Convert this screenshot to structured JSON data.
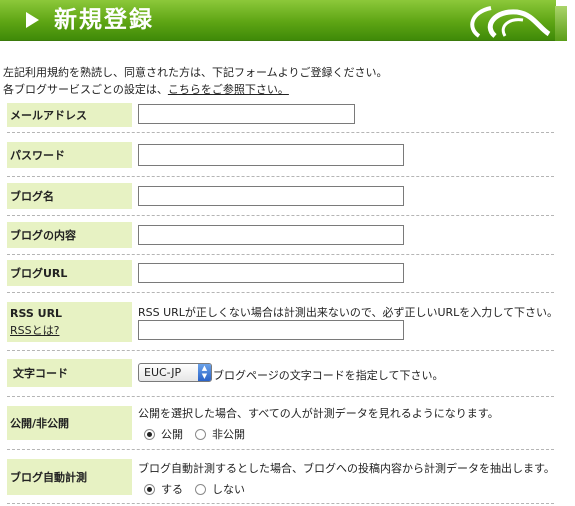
{
  "header": {
    "title": "新規登録"
  },
  "intro": {
    "line1": "左記利用規約を熟読し、同意された方は、下記フォームよりご登録ください。",
    "line2_prefix": "各ブログサービスごとの設定は、",
    "line2_link": "こちらをご参照下さい。"
  },
  "form": {
    "email": {
      "label": "メールアドレス",
      "value": ""
    },
    "password": {
      "label": "パスワード",
      "value": ""
    },
    "blog_name": {
      "label": "ブログ名",
      "value": ""
    },
    "blog_content": {
      "label": "ブログの内容",
      "value": ""
    },
    "blog_url": {
      "label": "ブログURL",
      "value": ""
    },
    "rss_url": {
      "label": "RSS URL",
      "link": "RSSとは?",
      "help": "RSS URLが正しくない場合は計測出来ないので、必ず正しいURLを入力して下さい。",
      "value": ""
    },
    "charset": {
      "label": "文字コード",
      "selected": "EUC-JP",
      "help": "ブログページの文字コードを指定して下さい。"
    },
    "visibility": {
      "label": "公開/非公開",
      "help": "公開を選択した場合、すべての人が計測データを見れるようになります。",
      "options": [
        "公開",
        "非公開"
      ],
      "selected": "公開"
    },
    "auto_measure": {
      "label": "ブログ自動計測",
      "help": "ブログ自動計測するとした場合、ブログへの投稿内容から計測データを抽出します。",
      "options": [
        "する",
        "しない"
      ],
      "selected": "する"
    }
  },
  "colors": {
    "header_green": "#5ea514",
    "label_bg": "#e7f2c3"
  }
}
